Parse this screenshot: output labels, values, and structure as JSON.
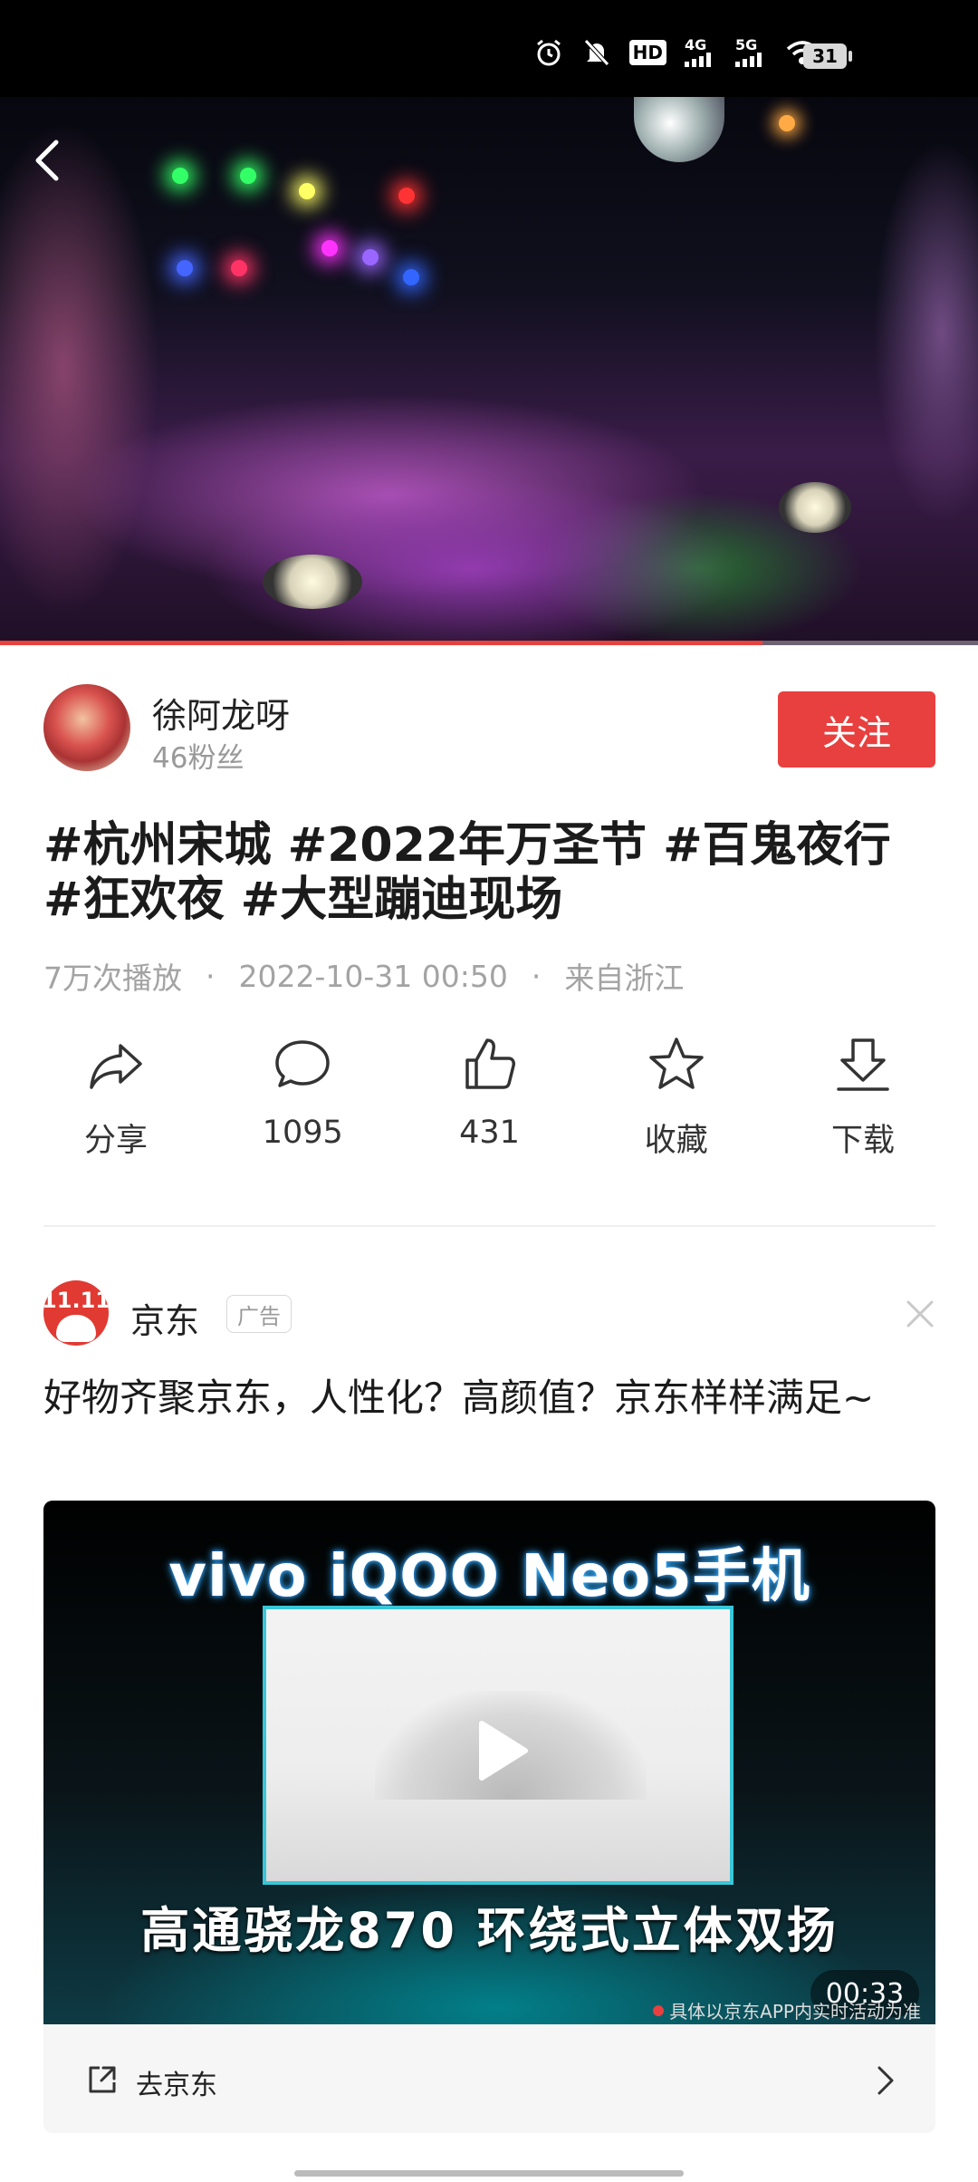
{
  "status_bar": {
    "icons": [
      "alarm-icon",
      "mute-icon",
      "hd-icon",
      "signal-4g-icon",
      "signal-5g-icon",
      "wifi-icon"
    ],
    "network_4g": "4G",
    "network_5g": "5G",
    "hd": "HD",
    "battery": "31"
  },
  "video": {
    "progress": 0.78
  },
  "author": {
    "name": "徐阿龙呀",
    "fans": "46粉丝",
    "follow_label": "关注"
  },
  "post": {
    "title": "#杭州宋城 #2022年万圣节 #百鬼夜行 #狂欢夜 #大型蹦迪现场",
    "plays": "7万次播放",
    "datetime": "2022-10-31 00:50",
    "location": "来自浙江",
    "separator": "·"
  },
  "actions": [
    {
      "name": "share",
      "icon": "share-icon",
      "label": "分享"
    },
    {
      "name": "comment",
      "icon": "comment-icon",
      "label": "1095"
    },
    {
      "name": "like",
      "icon": "thumbs-up-icon",
      "label": "431"
    },
    {
      "name": "favorite",
      "icon": "star-icon",
      "label": "收藏"
    },
    {
      "name": "download",
      "icon": "download-icon",
      "label": "下载"
    }
  ],
  "ad": {
    "logo_text": "11.11",
    "brand": "京东",
    "tag": "广告",
    "title": "好物齐聚京东，人性化？高颜值？京东样样满足~",
    "video_headline": "vivo  iQOO Neo5手机",
    "video_spec": "高通骁龙870 环绕式立体双扬",
    "duration": "00:33",
    "disclaimer": "具体以京东APP内实时活动为准",
    "cta_label": "去京东"
  }
}
